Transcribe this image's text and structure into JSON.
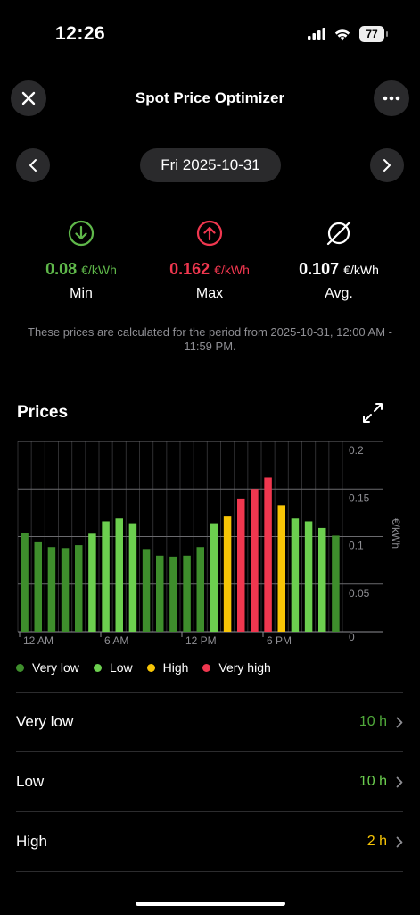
{
  "status": {
    "time": "12:26",
    "battery": "77"
  },
  "header": {
    "title": "Spot Price Optimizer"
  },
  "date_nav": {
    "date": "Fri 2025-10-31"
  },
  "stats": {
    "min": {
      "value": "0.08",
      "unit": "€/kWh",
      "label": "Min",
      "color": "#5fb84a"
    },
    "max": {
      "value": "0.162",
      "unit": "€/kWh",
      "label": "Max",
      "color": "#f0374f"
    },
    "avg": {
      "value": "0.107",
      "unit": "€/kWh",
      "label": "Avg.",
      "color": "#ffffff"
    }
  },
  "period_note": "These prices are calculated for the period from 2025-10-31, 12:00 AM - 11:59 PM.",
  "prices": {
    "title": "Prices"
  },
  "chart_data": {
    "type": "bar",
    "categories": [
      "0",
      "1",
      "2",
      "3",
      "4",
      "5",
      "6",
      "7",
      "8",
      "9",
      "10",
      "11",
      "12",
      "13",
      "14",
      "15",
      "16",
      "17",
      "18",
      "19",
      "20",
      "21",
      "22",
      "23"
    ],
    "x_tick_labels": [
      "12 AM",
      "6 AM",
      "12 PM",
      "6 PM"
    ],
    "values": [
      0.104,
      0.094,
      0.089,
      0.088,
      0.091,
      0.103,
      0.116,
      0.119,
      0.114,
      0.087,
      0.08,
      0.079,
      0.08,
      0.089,
      0.114,
      0.121,
      0.14,
      0.15,
      0.162,
      0.133,
      0.119,
      0.116,
      0.109,
      0.101
    ],
    "levels": [
      "very_low",
      "very_low",
      "very_low",
      "very_low",
      "very_low",
      "low",
      "low",
      "low",
      "low",
      "very_low",
      "very_low",
      "very_low",
      "very_low",
      "very_low",
      "low",
      "high",
      "very_high",
      "very_high",
      "very_high",
      "high",
      "low",
      "low",
      "low",
      "very_low"
    ],
    "level_colors": {
      "very_low": "#3e8e2c",
      "low": "#6ccf4f",
      "high": "#f7c506",
      "very_high": "#f0374f"
    },
    "ylabel": "€/kWh",
    "ylim": [
      0,
      0.2
    ],
    "y_ticks": [
      "0",
      "0.05",
      "0.1",
      "0.15",
      "0.2"
    ],
    "grid": true
  },
  "legend": [
    {
      "label": "Very low",
      "color": "#3e8e2c"
    },
    {
      "label": "Low",
      "color": "#6ccf4f"
    },
    {
      "label": "High",
      "color": "#f7c506"
    },
    {
      "label": "Very high",
      "color": "#f0374f"
    }
  ],
  "rows": [
    {
      "label": "Very low",
      "value": "10 h",
      "color": "#4fa83a"
    },
    {
      "label": "Low",
      "value": "10 h",
      "color": "#6ccf4f"
    },
    {
      "label": "High",
      "value": "2 h",
      "color": "#f7c506"
    }
  ]
}
